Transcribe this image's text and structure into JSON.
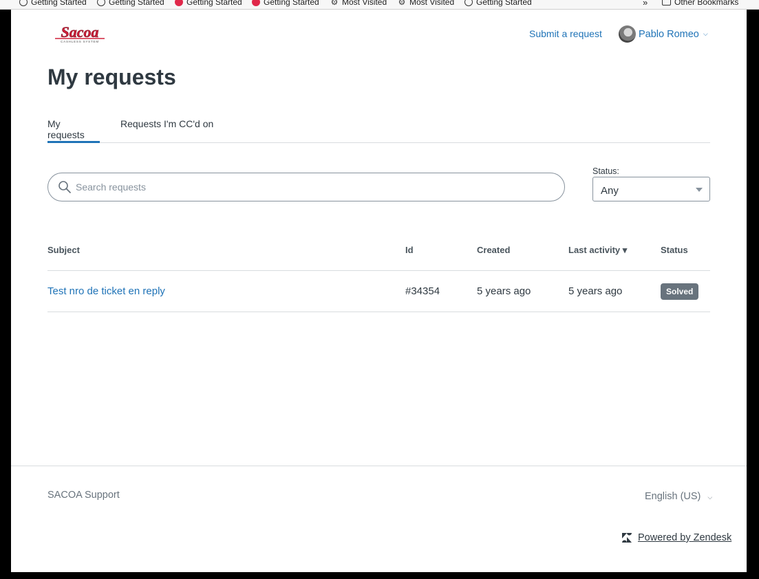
{
  "bookmarks": [
    {
      "label": "Getting Started",
      "icon": "globe-icon"
    },
    {
      "label": "Getting Started",
      "icon": "globe-icon"
    },
    {
      "label": "Getting Started",
      "icon": "firefox-icon"
    },
    {
      "label": "Getting Started",
      "icon": "firefox-icon"
    },
    {
      "label": "Most Visited",
      "icon": "gear-icon"
    },
    {
      "label": "Most Visited",
      "icon": "gear-icon"
    },
    {
      "label": "Getting Started",
      "icon": "globe-icon"
    },
    {
      "label": "Other Bookmarks",
      "icon": "folder-icon"
    }
  ],
  "header": {
    "logo_text": "Sacoa",
    "logo_sub": "CASHLESS SYSTEM",
    "submit_label": "Submit a request",
    "user_name": "Pablo Romeo"
  },
  "page_title": "My requests",
  "tabs": [
    {
      "label": "My requests",
      "active": true
    },
    {
      "label": "Requests I'm CC'd on",
      "active": false
    }
  ],
  "search": {
    "placeholder": "Search requests"
  },
  "status_filter": {
    "label": "Status:",
    "value": "Any"
  },
  "table": {
    "headers": {
      "subject": "Subject",
      "id": "Id",
      "created": "Created",
      "last_activity": "Last activity ▾",
      "status": "Status"
    },
    "rows": [
      {
        "subject": "Test nro de ticket en reply",
        "id": "#34354",
        "created": "5 years ago",
        "last_activity": "5 years ago",
        "status": "Solved"
      }
    ]
  },
  "footer": {
    "brand": "SACOA Support",
    "language": "English (US)",
    "powered_by": "Powered by Zendesk"
  },
  "colors": {
    "link": "#1f73b7",
    "badge": "#68737d",
    "logo_red": "#d1203a"
  }
}
